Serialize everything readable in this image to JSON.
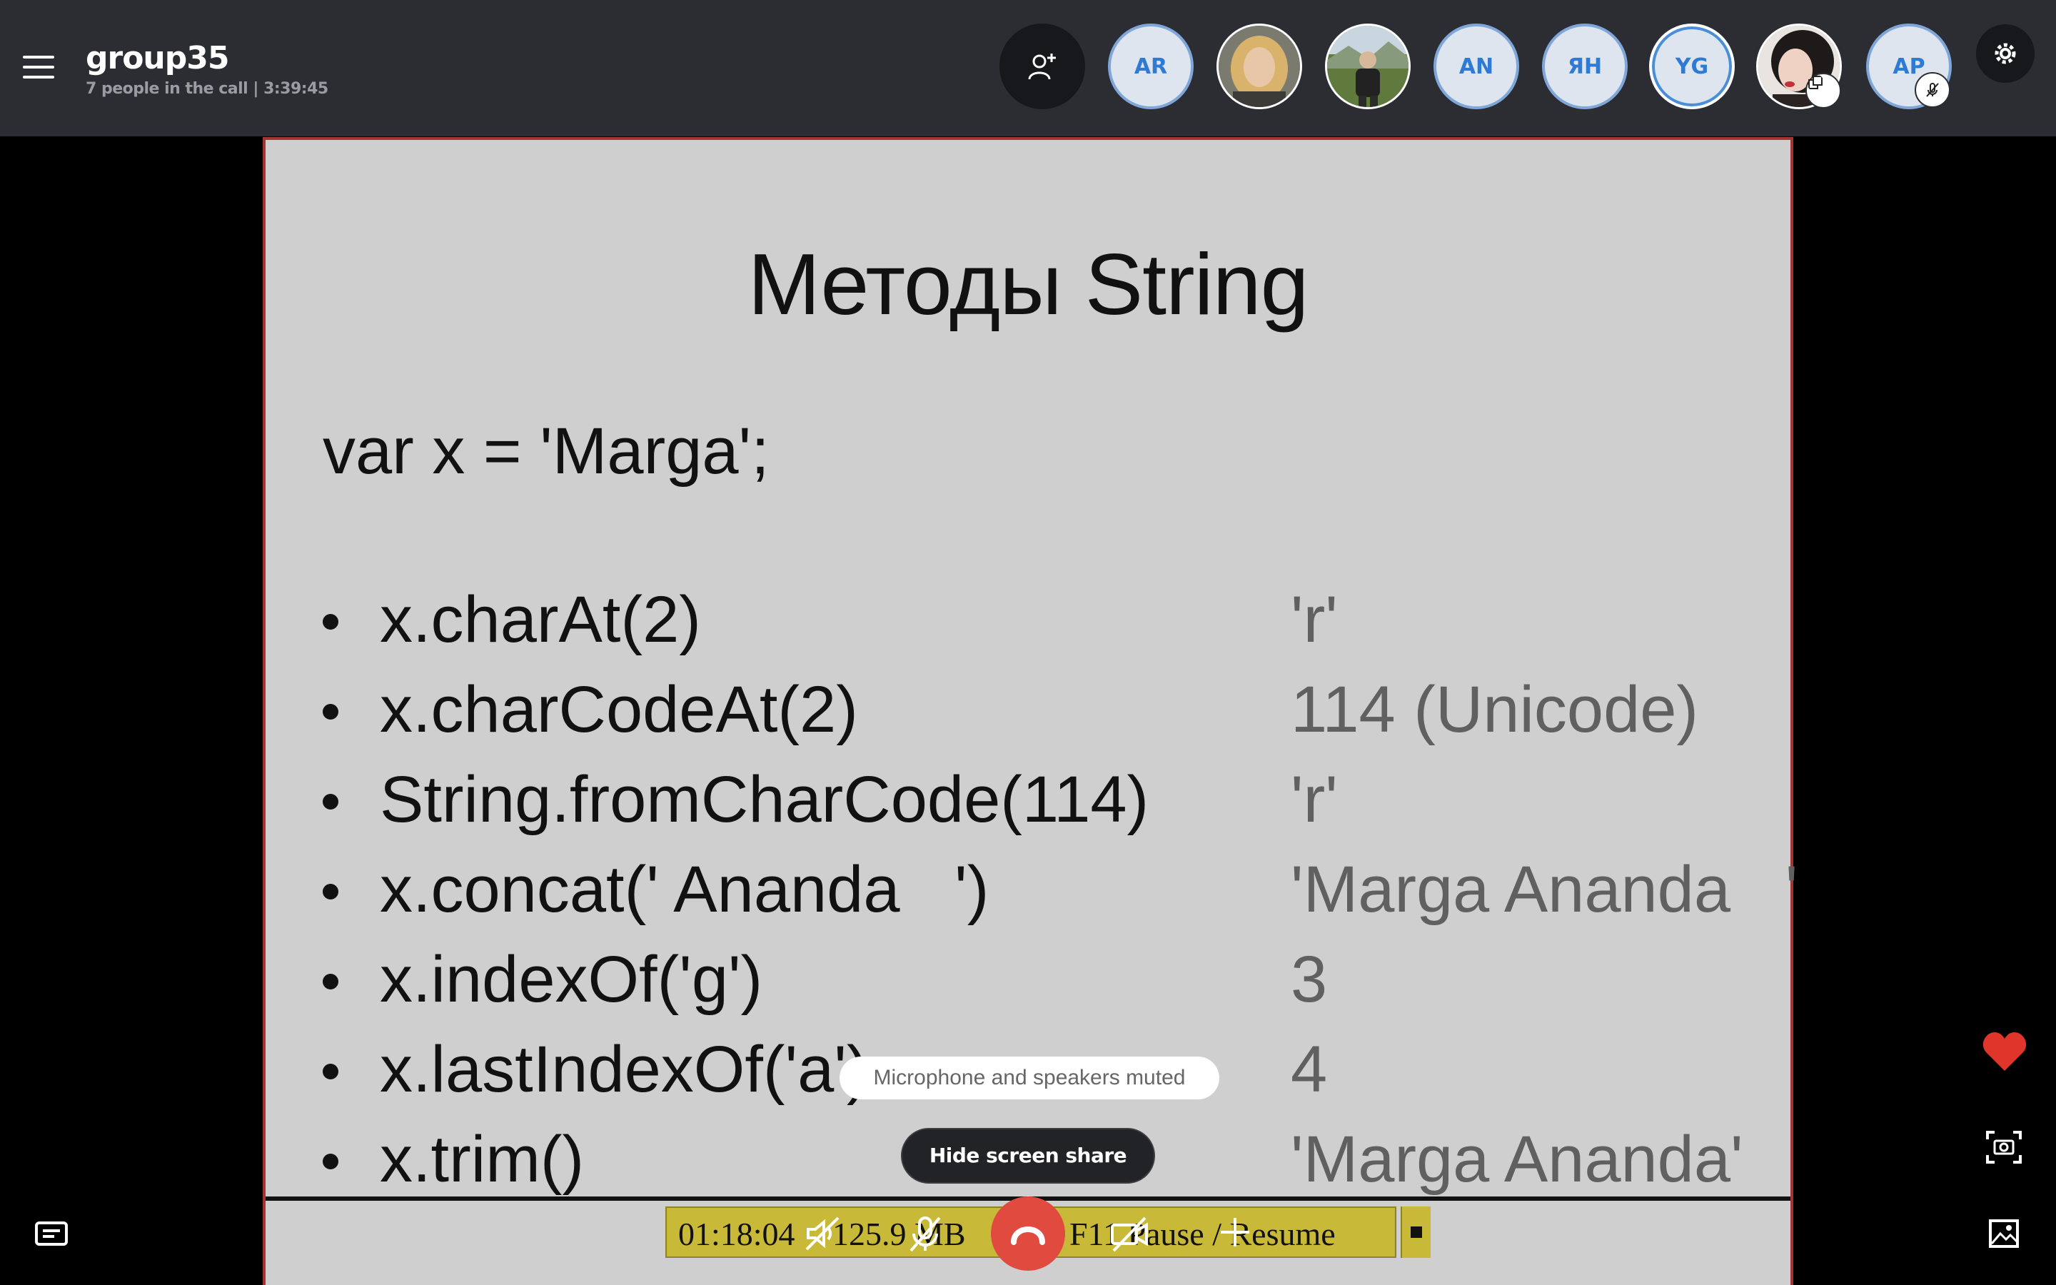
{
  "header": {
    "title": "group35",
    "subtitle": "7 people in the call | 3:39:45"
  },
  "participants": [
    {
      "kind": "initials",
      "label": "AR"
    },
    {
      "kind": "photo",
      "label": ""
    },
    {
      "kind": "photo",
      "label": ""
    },
    {
      "kind": "initials",
      "label": "AN"
    },
    {
      "kind": "initials",
      "label": "ЯН"
    },
    {
      "kind": "initials",
      "label": "YG"
    },
    {
      "kind": "photo",
      "label": ""
    },
    {
      "kind": "initials",
      "label": "AP"
    }
  ],
  "slide": {
    "title": "Методы String",
    "declaration": "var x = 'Marga';",
    "bullets": [
      {
        "code": "x.charAt(2)",
        "result": "'r'"
      },
      {
        "code": "x.charCodeAt(2)",
        "result": "114 (Unicode)"
      },
      {
        "code": "String.fromCharCode(114)",
        "result": "'r'"
      },
      {
        "code": "x.concat(' Ananda   ')",
        "result": "'Marga Ananda   '"
      },
      {
        "code": "x.indexOf('g')",
        "result": "3"
      },
      {
        "code": "x.lastIndexOf('a')",
        "result": "4"
      },
      {
        "code": "x.trim()",
        "result": "'Marga Ananda'"
      }
    ]
  },
  "recorder": {
    "time": "01:18:04",
    "size": "125.9 MB",
    "keys": "F11 Pause / Resume"
  },
  "toast": "Microphone and speakers muted",
  "hide_share_label": "Hide screen share",
  "colors": {
    "topbar": "#2b2d33",
    "hangup": "#e04a3f",
    "heart": "#e0352b",
    "avatar_text": "#2f7bd3"
  }
}
